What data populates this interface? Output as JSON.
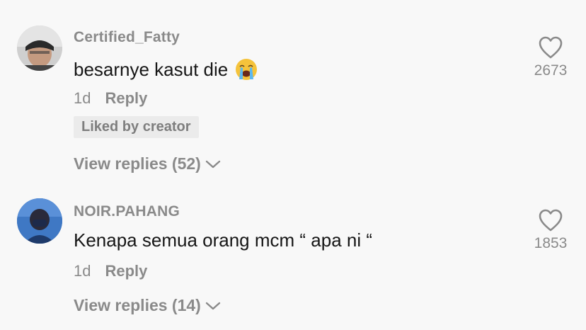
{
  "comments": [
    {
      "username": "Certified_Fatty",
      "text": "besarnye kasut die",
      "emoji": "loudly-crying-face-emoji",
      "time": "1d",
      "reply_label": "Reply",
      "badge": "Liked by creator",
      "view_replies": "View replies (52)",
      "likes": "2673"
    },
    {
      "username": "NOIR.PAHANG",
      "text": "Kenapa semua orang mcm “ apa ni “",
      "time": "1d",
      "reply_label": "Reply",
      "view_replies": "View replies (14)",
      "likes": "1853"
    }
  ],
  "icons": {
    "like": "heart-outline-icon",
    "expand": "chevron-down-icon"
  },
  "colors": {
    "background": "#f8f8f8",
    "primary_text": "#161616",
    "secondary_text": "#8a8a8a",
    "badge_bg": "#ebebeb"
  }
}
